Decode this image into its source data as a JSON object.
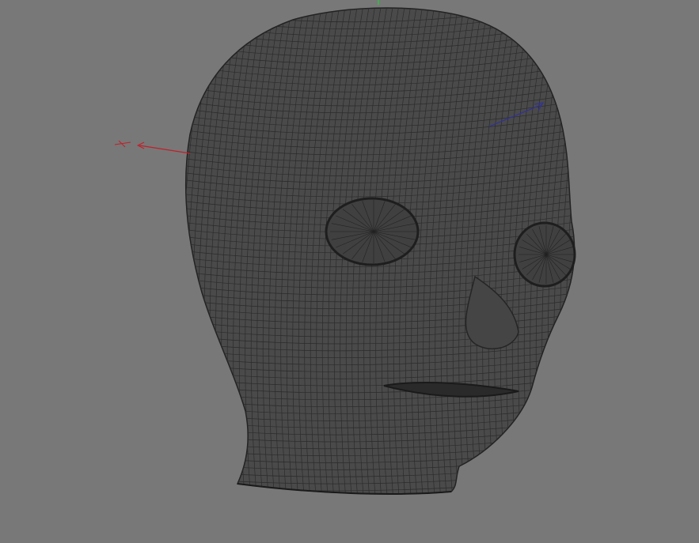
{
  "viewport": {
    "background": "#787878",
    "mesh_fill": "#4a4a4a",
    "mesh_wire": "#2a2a2a",
    "axes": {
      "x_color": "#c0202a",
      "y_color": "#30c040",
      "z_color": "#3030a0"
    }
  }
}
